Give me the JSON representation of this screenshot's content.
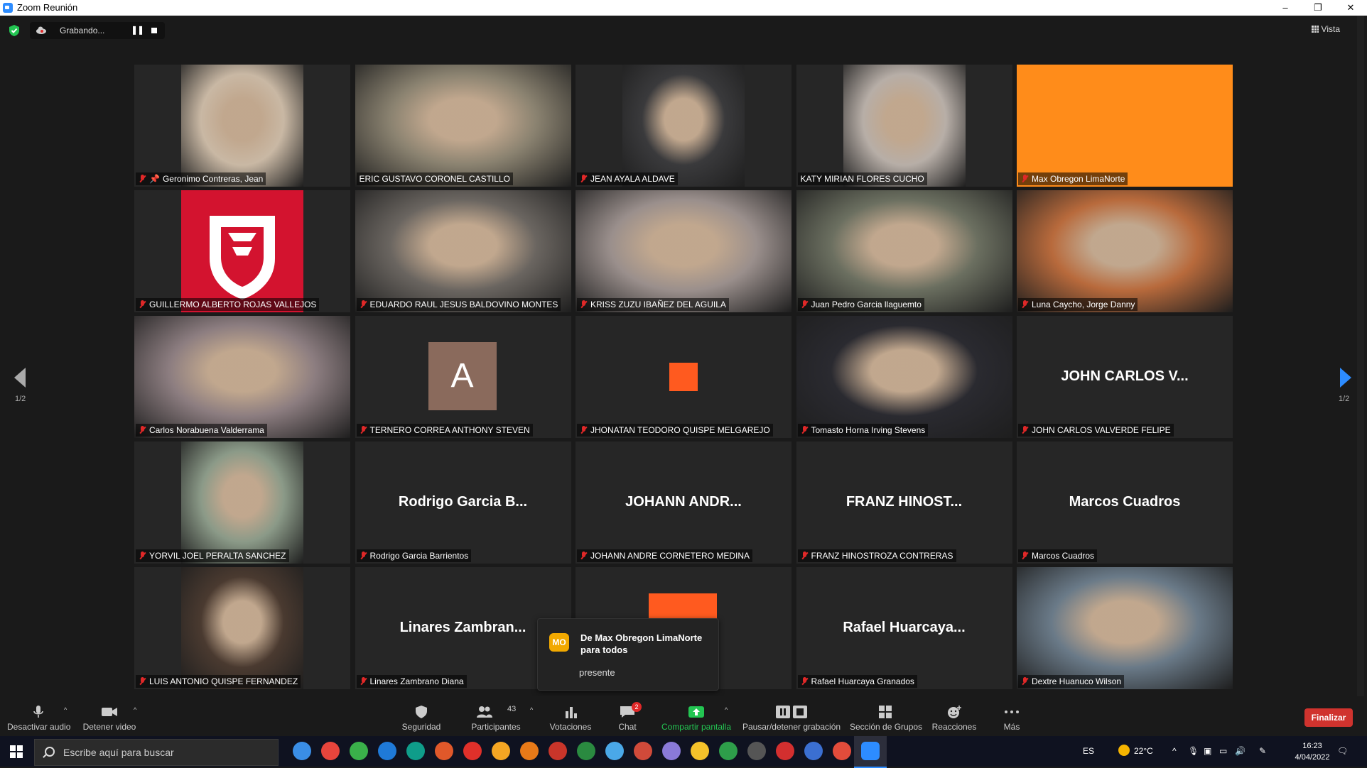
{
  "window": {
    "title": "Zoom Reunión",
    "minimize": "–",
    "restore": "❐",
    "close": "✕"
  },
  "status": {
    "recording_label": "Grabando...",
    "view_label": "Vista"
  },
  "pagination": {
    "left_label": "1/2",
    "right_label": "1/2"
  },
  "participants": [
    {
      "name": "Geronimo Contreras, Jean",
      "type": "video",
      "vcolor": "#c9b8a4",
      "muted": true,
      "pinned": true
    },
    {
      "name": "ERIC GUSTAVO CORONEL CASTILLO",
      "type": "video",
      "vcolor": "#8a8270",
      "muted": false,
      "active": true
    },
    {
      "name": "JEAN AYALA ALDAVE",
      "type": "video",
      "vcolor": "#3a3a3c",
      "muted": true
    },
    {
      "name": "KATY MIRIAN FLORES CUCHO",
      "type": "video",
      "vcolor": "#b7aea7",
      "muted": false
    },
    {
      "name": "Max Obregon LimaNorte",
      "type": "color",
      "vcolor": "#ff8c1a",
      "muted": true
    },
    {
      "name": "GUILLERMO ALBERTO ROJAS VALLEJOS",
      "type": "logo",
      "vcolor": "#d3132f",
      "muted": true
    },
    {
      "name": "EDUARDO RAUL JESUS BALDOVINO MONTES",
      "type": "video",
      "vcolor": "#6a6560",
      "muted": true
    },
    {
      "name": "KRISS ZUZU IBAÑEZ DEL AGUILA",
      "type": "video",
      "vcolor": "#9a8f8c",
      "muted": true
    },
    {
      "name": "Juan Pedro Garcia llaguemto",
      "type": "video",
      "vcolor": "#6b6f60",
      "muted": true
    },
    {
      "name": "Luna Caycho, Jorge Danny",
      "type": "video",
      "vcolor": "#b86a3c",
      "muted": true
    },
    {
      "name": "Carlos Norabuena Valderrama",
      "type": "video",
      "vcolor": "#8c7d80",
      "muted": true
    },
    {
      "name": "TERNERO CORREA ANTHONY STEVEN",
      "type": "letter",
      "letter": "A",
      "muted": true
    },
    {
      "name": "JHONATAN TEODORO QUISPE MELGAREJO",
      "type": "orange",
      "muted": true
    },
    {
      "name": "Tomasto Horna Irving Stevens",
      "type": "video",
      "vcolor": "#2a2a30",
      "muted": true
    },
    {
      "name": "JOHN CARLOS VALVERDE FELIPE",
      "type": "text",
      "display": "JOHN CARLOS V...",
      "muted": true
    },
    {
      "name": "YORVIL JOEL PERALTA SANCHEZ",
      "type": "video",
      "vcolor": "#8b9a88",
      "muted": true
    },
    {
      "name": "Rodrigo Garcia Barrientos",
      "type": "text",
      "display": "Rodrigo Garcia B...",
      "muted": true
    },
    {
      "name": "JOHANN ANDRE CORNETERO MEDINA",
      "type": "text",
      "display": "JOHANN  ANDR...",
      "muted": true
    },
    {
      "name": "FRANZ HINOSTROZA CONTRERAS",
      "type": "text",
      "display": "FRANZ  HINOST...",
      "muted": true
    },
    {
      "name": "Marcos Cuadros",
      "type": "text",
      "display": "Marcos Cuadros",
      "muted": true
    },
    {
      "name": "LUIS ANTONIO QUISPE FERNANDEZ",
      "type": "video",
      "vcolor": "#4a3a30",
      "muted": true
    },
    {
      "name": "Linares Zambrano Diana",
      "type": "text",
      "display": "Linares  Zambran...",
      "muted": true
    },
    {
      "name": "",
      "type": "orange-top",
      "muted": false
    },
    {
      "name": "Rafael Huarcaya Granados",
      "type": "text",
      "display": "Rafael  Huarcaya...",
      "muted": true
    },
    {
      "name": "Dextre Huanuco Wilson",
      "type": "video",
      "vcolor": "#6a7a88",
      "muted": true
    }
  ],
  "chat_popup": {
    "avatar": "MO",
    "from": "De Max Obregon LimaNorte para todos",
    "message": "presente"
  },
  "toolbar": {
    "audio": "Desactivar audio",
    "video": "Detener video",
    "security": "Seguridad",
    "participants": "Participantes",
    "participants_count": "43",
    "polls": "Votaciones",
    "chat": "Chat",
    "chat_badge": "2",
    "share": "Compartir pantalla",
    "record": "Pausar/detener grabación",
    "breakout": "Sección de Grupos",
    "reactions": "Reacciones",
    "more": "Más",
    "end": "Finalizar"
  },
  "taskbar": {
    "search_placeholder": "Escribe aquí para buscar",
    "lang": "ES",
    "temp": "22°C",
    "time": "16:23",
    "date": "4/04/2022",
    "apps": [
      "#3a8ee6",
      "#e8453c",
      "#3ab04a",
      "#1f7ad8",
      "#0f9d8a",
      "#e0582a",
      "#e0302a",
      "#f5a623",
      "#e87a18",
      "#c9352a",
      "#2a8a40",
      "#4aa8e8",
      "#d04a3a",
      "#8a7ad8",
      "#f5c22a",
      "#2e9e4a",
      "#555555",
      "#d32f2f",
      "#3b6fd1",
      "#e34c3b",
      "#2d8cff"
    ],
    "accent": "#2d8cff"
  }
}
